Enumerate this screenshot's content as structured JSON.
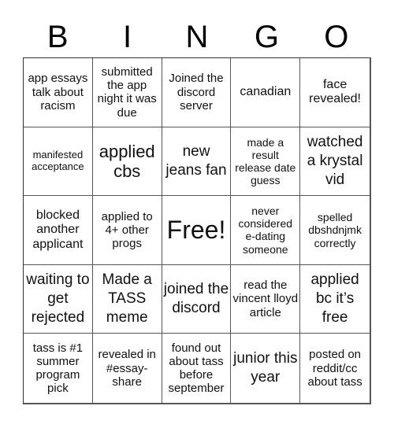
{
  "header": {
    "letters": [
      "B",
      "I",
      "N",
      "G",
      "O"
    ]
  },
  "board": {
    "cells": [
      "app essays talk about racism",
      "submitted the app night it was due",
      "Joined the discord server",
      "canadian",
      "face revealed!",
      "manifested acceptance",
      "applied cbs",
      "new jeans fan",
      "made a result release date guess",
      "watched a krystal vid",
      "blocked another applicant",
      "applied to 4+ other progs",
      "Free!",
      "never considered e-dating someone",
      "spelled dbshdnjmk correctly",
      "waiting to get rejected",
      "Made a TASS meme",
      "joined the discord",
      "read the vincent lloyd article",
      "applied bc it’s free",
      "tass is #1 summer program pick",
      "revealed in #essay-share",
      "found out about tass before september",
      "junior this year",
      "posted on reddit/cc about tass"
    ],
    "free_space_index": 12
  }
}
